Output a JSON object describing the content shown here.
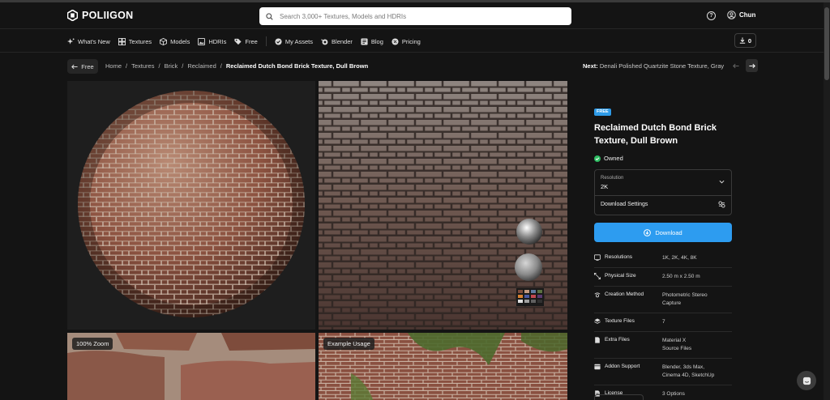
{
  "brand": {
    "name": "POLIIGON"
  },
  "search": {
    "placeholder": "Search 3,000+ Textures, Models and HDRIs"
  },
  "user": {
    "name": "Chun"
  },
  "nav": {
    "items": [
      {
        "label": "What's New",
        "icon": "sparkle-icon"
      },
      {
        "label": "Textures",
        "icon": "grid-icon"
      },
      {
        "label": "Models",
        "icon": "cube-icon"
      },
      {
        "label": "HDRIs",
        "icon": "image-icon"
      },
      {
        "label": "Free",
        "icon": "tag-icon"
      },
      {
        "label": "My Assets",
        "icon": "check-circle-icon"
      },
      {
        "label": "Blender",
        "icon": "blender-icon"
      },
      {
        "label": "Blog",
        "icon": "blog-icon"
      },
      {
        "label": "Pricing",
        "icon": "pricing-icon"
      }
    ],
    "download_count": "0"
  },
  "breadcrumb": {
    "back_label": "Free",
    "items": [
      "Home",
      "/",
      "Textures",
      "/",
      "Brick",
      "/",
      "Reclaimed",
      "/"
    ],
    "current": "Reclaimed Dutch Bond Brick Texture, Dull Brown"
  },
  "next": {
    "prefix": "Next:",
    "title": "Denali Polished Quartzite Stone Texture, Gray"
  },
  "gallery": {
    "chips": [
      "100% Zoom",
      "Example Usage"
    ]
  },
  "asset": {
    "badge": "FREE",
    "title": "Reclaimed Dutch Bond Brick Texture, Dull Brown",
    "status": "Owned",
    "resolution_label": "Resolution",
    "resolution_value": "2K",
    "download_settings_label": "Download Settings",
    "download_label": "Download",
    "specs": [
      {
        "key": "Resolutions",
        "icon": "resolution-icon",
        "value": [
          "1K, 2K, 4K, 8K"
        ]
      },
      {
        "key": "Physical Size",
        "icon": "resize-icon",
        "value": [
          "2.50 m x 2.50 m"
        ]
      },
      {
        "key": "Creation Method",
        "icon": "camera-icon",
        "value": [
          "Photometric Stereo",
          "Capture"
        ]
      },
      {
        "key": "Texture Files",
        "icon": "layers-icon",
        "value": [
          "7"
        ]
      },
      {
        "key": "Extra Files",
        "icon": "file-icon",
        "value": [
          "Material X",
          "Source Files"
        ]
      },
      {
        "key": "Addon Support",
        "icon": "addon-icon",
        "value": [
          "Blender, 3ds Max,",
          "Cinema 4D, SketchUp"
        ]
      },
      {
        "key": "License",
        "icon": "license-icon",
        "value": [
          "3 Options"
        ]
      }
    ]
  },
  "colors": {
    "accent": "#2d9cf0",
    "owned": "#2dbd62",
    "background": "#141414"
  }
}
